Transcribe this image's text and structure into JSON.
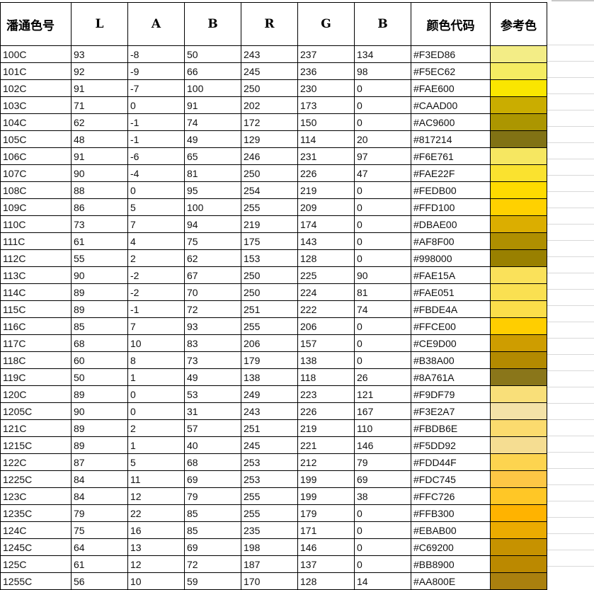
{
  "headers": [
    "潘通色号",
    "L",
    "A",
    "B",
    "R",
    "G",
    "B",
    "颜色代码",
    "参考色"
  ],
  "rows": [
    {
      "name": "100C",
      "L": "93",
      "A": "-8",
      "B": "50",
      "R": "243",
      "G": "237",
      "B2": "134",
      "hex": "#F3ED86",
      "color": "#F3ED86"
    },
    {
      "name": "101C",
      "L": "92",
      "A": "-9",
      "B": "66",
      "R": "245",
      "G": "236",
      "B2": "98",
      "hex": "#F5EC62",
      "color": "#F5EC62"
    },
    {
      "name": "102C",
      "L": "91",
      "A": "-7",
      "B": "100",
      "R": "250",
      "G": "230",
      "B2": "0",
      "hex": "#FAE600",
      "color": "#FAE600"
    },
    {
      "name": "103C",
      "L": "71",
      "A": "0",
      "B": "91",
      "R": "202",
      "G": "173",
      "B2": "0",
      "hex": "#CAAD00",
      "color": "#CAAD00"
    },
    {
      "name": "104C",
      "L": "62",
      "A": "-1",
      "B": "74",
      "R": "172",
      "G": "150",
      "B2": "0",
      "hex": "#AC9600",
      "color": "#AC9600"
    },
    {
      "name": "105C",
      "L": "48",
      "A": "-1",
      "B": "49",
      "R": "129",
      "G": "114",
      "B2": "20",
      "hex": "#817214",
      "color": "#817214"
    },
    {
      "name": "106C",
      "L": "91",
      "A": "-6",
      "B": "65",
      "R": "246",
      "G": "231",
      "B2": "97",
      "hex": "#F6E761",
      "color": "#F6E761"
    },
    {
      "name": "107C",
      "L": "90",
      "A": "-4",
      "B": "81",
      "R": "250",
      "G": "226",
      "B2": "47",
      "hex": "#FAE22F",
      "color": "#FAE22F"
    },
    {
      "name": "108C",
      "L": "88",
      "A": "0",
      "B": "95",
      "R": "254",
      "G": "219",
      "B2": "0",
      "hex": "#FEDB00",
      "color": "#FEDB00"
    },
    {
      "name": "109C",
      "L": "86",
      "A": "5",
      "B": "100",
      "R": "255",
      "G": "209",
      "B2": "0",
      "hex": "#FFD100",
      "color": "#FFD100"
    },
    {
      "name": "110C",
      "L": "73",
      "A": "7",
      "B": "94",
      "R": "219",
      "G": "174",
      "B2": "0",
      "hex": "#DBAE00",
      "color": "#DBAE00"
    },
    {
      "name": "111C",
      "L": "61",
      "A": "4",
      "B": "75",
      "R": "175",
      "G": "143",
      "B2": "0",
      "hex": "#AF8F00",
      "color": "#AF8F00"
    },
    {
      "name": "112C",
      "L": "55",
      "A": "2",
      "B": "62",
      "R": "153",
      "G": "128",
      "B2": "0",
      "hex": "#998000",
      "color": "#998000"
    },
    {
      "name": "113C",
      "L": "90",
      "A": "-2",
      "B": "67",
      "R": "250",
      "G": "225",
      "B2": "90",
      "hex": "#FAE15A",
      "color": "#FAE15A"
    },
    {
      "name": "114C",
      "L": "89",
      "A": "-2",
      "B": "70",
      "R": "250",
      "G": "224",
      "B2": "81",
      "hex": "#FAE051",
      "color": "#FAE051"
    },
    {
      "name": "115C",
      "L": "89",
      "A": "-1",
      "B": "72",
      "R": "251",
      "G": "222",
      "B2": "74",
      "hex": "#FBDE4A",
      "color": "#FBDE4A"
    },
    {
      "name": "116C",
      "L": "85",
      "A": "7",
      "B": "93",
      "R": "255",
      "G": "206",
      "B2": "0",
      "hex": "#FFCE00",
      "color": "#FFCE00"
    },
    {
      "name": "117C",
      "L": "68",
      "A": "10",
      "B": "83",
      "R": "206",
      "G": "157",
      "B2": "0",
      "hex": "#CE9D00",
      "color": "#CE9D00"
    },
    {
      "name": "118C",
      "L": "60",
      "A": "8",
      "B": "73",
      "R": "179",
      "G": "138",
      "B2": "0",
      "hex": "#B38A00",
      "color": "#B38A00"
    },
    {
      "name": "119C",
      "L": "50",
      "A": "1",
      "B": "49",
      "R": "138",
      "G": "118",
      "B2": "26",
      "hex": "#8A761A",
      "color": "#8A761A"
    },
    {
      "name": "120C",
      "L": "89",
      "A": "0",
      "B": "53",
      "R": "249",
      "G": "223",
      "B2": "121",
      "hex": "#F9DF79",
      "color": "#F9DF79"
    },
    {
      "name": "1205C",
      "L": "90",
      "A": "0",
      "B": "31",
      "R": "243",
      "G": "226",
      "B2": "167",
      "hex": "#F3E2A7",
      "color": "#F3E2A7"
    },
    {
      "name": "121C",
      "L": "89",
      "A": "2",
      "B": "57",
      "R": "251",
      "G": "219",
      "B2": "110",
      "hex": "#FBDB6E",
      "color": "#FBDB6E"
    },
    {
      "name": "1215C",
      "L": "89",
      "A": "1",
      "B": "40",
      "R": "245",
      "G": "221",
      "B2": "146",
      "hex": "#F5DD92",
      "color": "#F5DD92"
    },
    {
      "name": "122C",
      "L": "87",
      "A": "5",
      "B": "68",
      "R": "253",
      "G": "212",
      "B2": "79",
      "hex": "#FDD44F",
      "color": "#FDD44F"
    },
    {
      "name": "1225C",
      "L": "84",
      "A": "11",
      "B": "69",
      "R": "253",
      "G": "199",
      "B2": "69",
      "hex": "#FDC745",
      "color": "#FDC745"
    },
    {
      "name": "123C",
      "L": "84",
      "A": "12",
      "B": "79",
      "R": "255",
      "G": "199",
      "B2": "38",
      "hex": "#FFC726",
      "color": "#FFC726"
    },
    {
      "name": "1235C",
      "L": "79",
      "A": "22",
      "B": "85",
      "R": "255",
      "G": "179",
      "B2": "0",
      "hex": "#FFB300",
      "color": "#FFB300"
    },
    {
      "name": "124C",
      "L": "75",
      "A": "16",
      "B": "85",
      "R": "235",
      "G": "171",
      "B2": "0",
      "hex": "#EBAB00",
      "color": "#EBAB00"
    },
    {
      "name": "1245C",
      "L": "64",
      "A": "13",
      "B": "69",
      "R": "198",
      "G": "146",
      "B2": "0",
      "hex": "#C69200",
      "color": "#C69200"
    },
    {
      "name": "125C",
      "L": "61",
      "A": "12",
      "B": "72",
      "R": "187",
      "G": "137",
      "B2": "0",
      "hex": "#BB8900",
      "color": "#BB8900"
    },
    {
      "name": "1255C",
      "L": "56",
      "A": "10",
      "B": "59",
      "R": "170",
      "G": "128",
      "B2": "14",
      "hex": "#AA800E",
      "color": "#AA800E"
    }
  ]
}
